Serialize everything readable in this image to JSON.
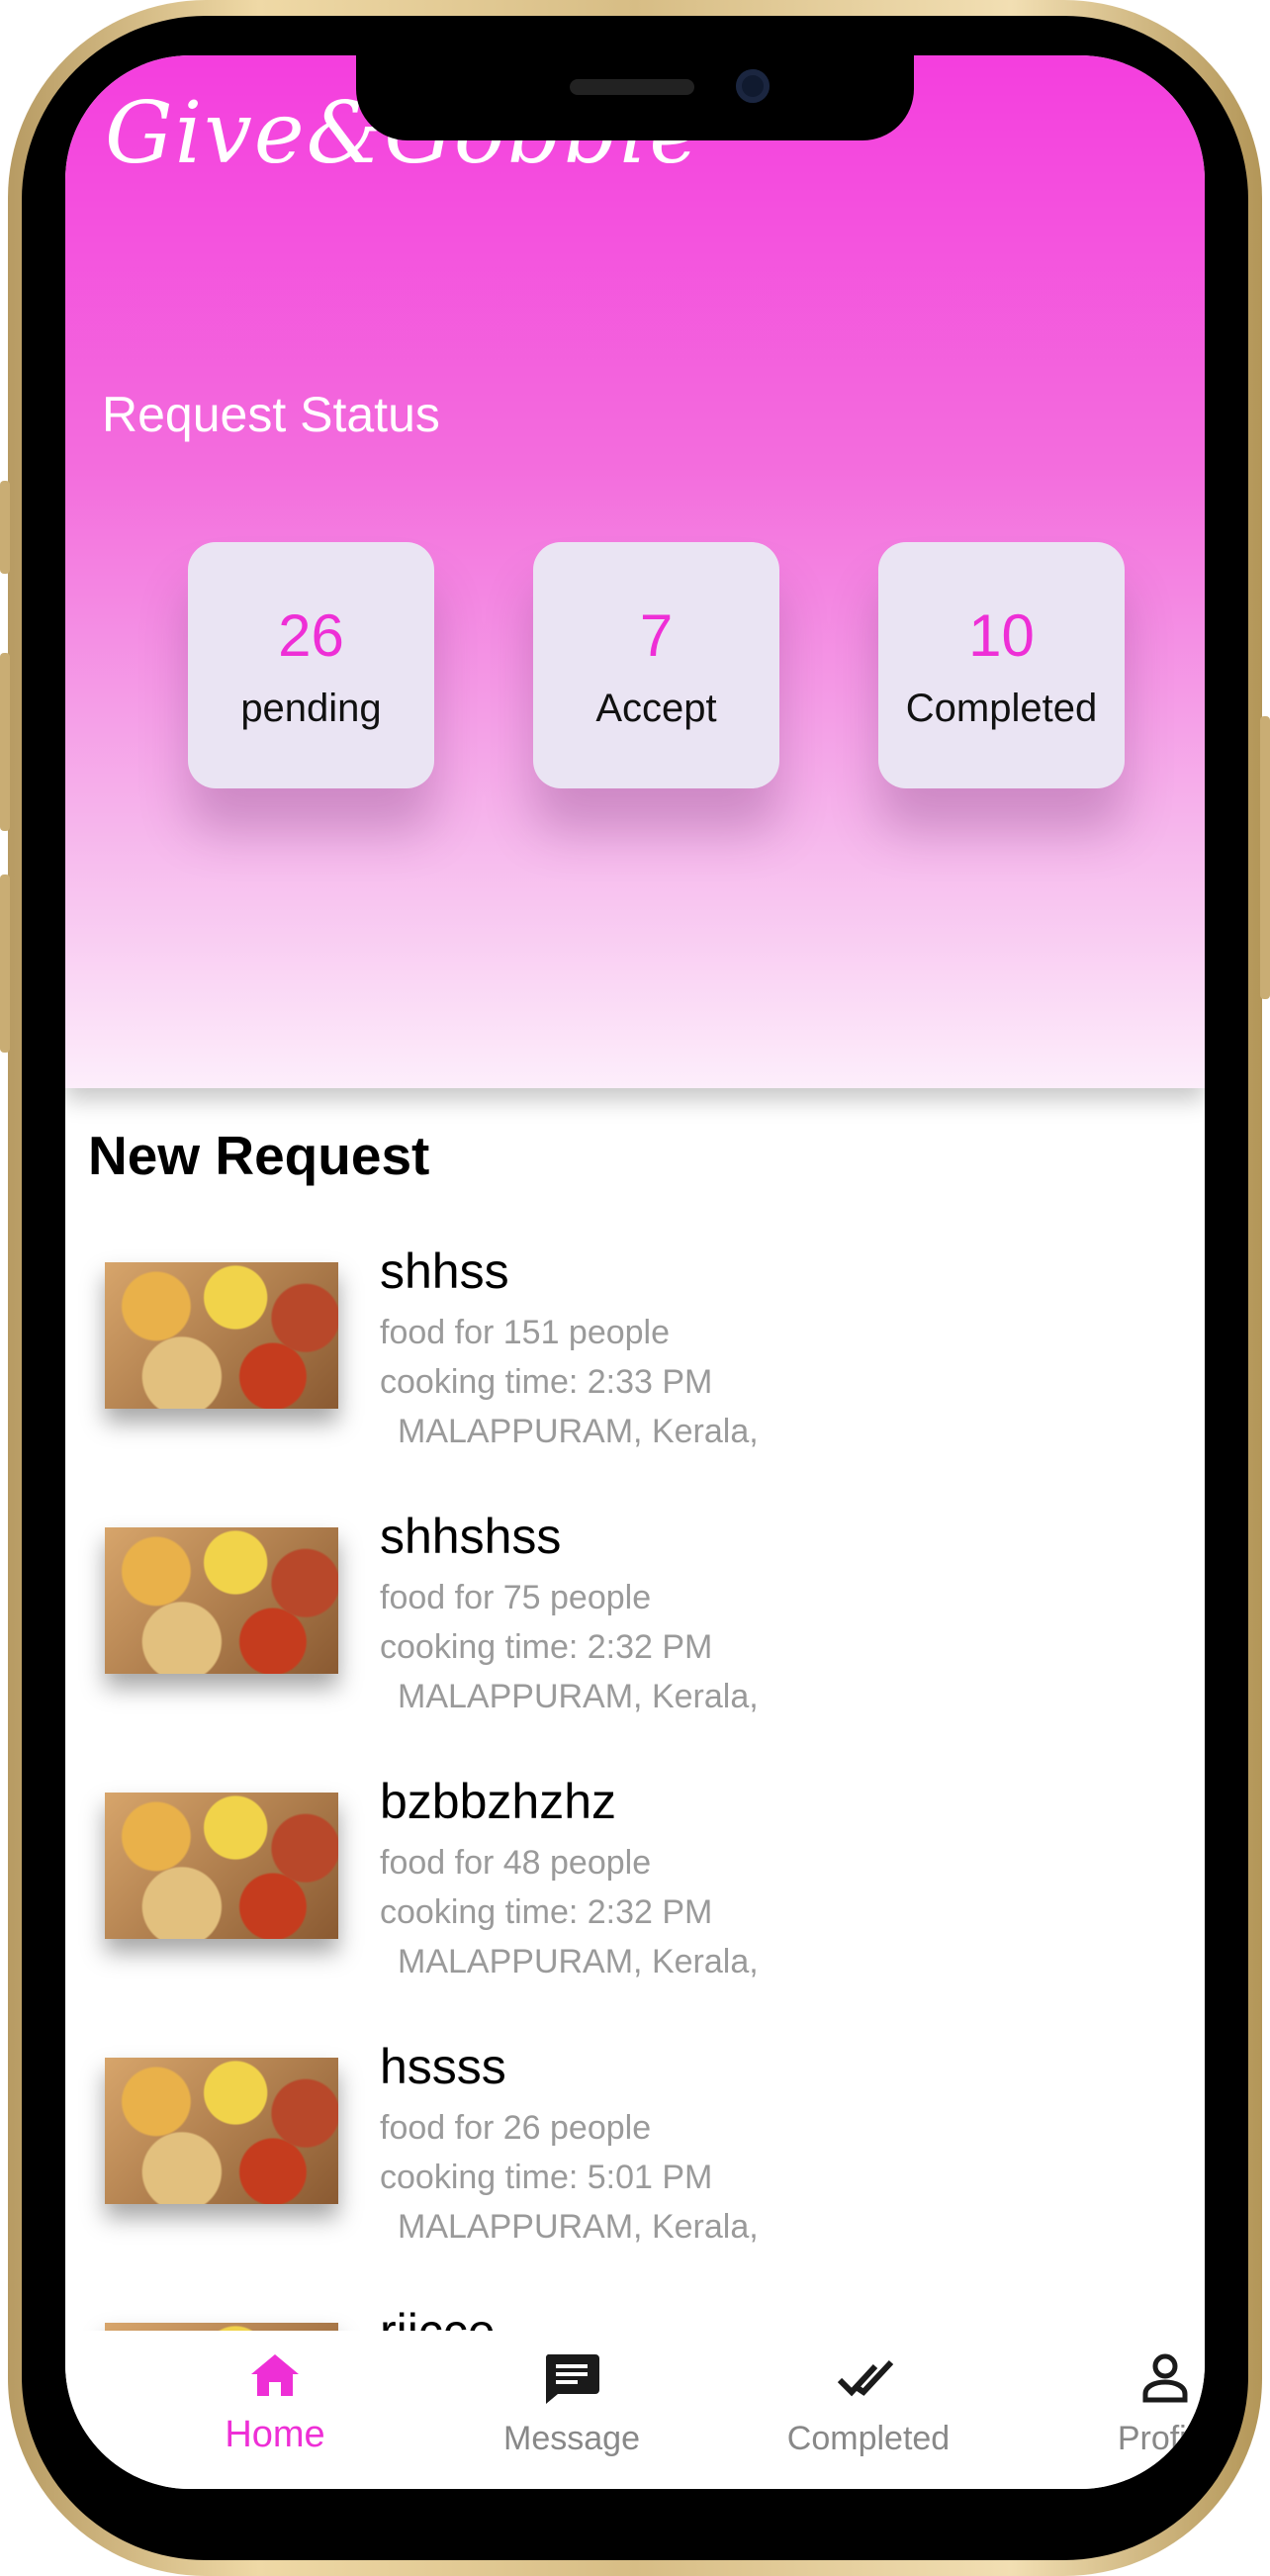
{
  "app": {
    "logo": "Give&Gobble"
  },
  "status": {
    "title": "Request Status",
    "cards": [
      {
        "value": "26",
        "label": "pending"
      },
      {
        "value": "7",
        "label": "Accept"
      },
      {
        "value": "10",
        "label": "Completed"
      }
    ]
  },
  "requests": {
    "title": "New Request",
    "items": [
      {
        "name": "shhss",
        "food": "food for 151 people",
        "time": "cooking time:  2:33 PM",
        "location": "MALAPPURAM, Kerala,"
      },
      {
        "name": "shhshss",
        "food": "food for 75 people",
        "time": "cooking time:  2:32 PM",
        "location": "MALAPPURAM, Kerala,"
      },
      {
        "name": "bzbbzhzhz",
        "food": "food for 48 people",
        "time": "cooking time:  2:32 PM",
        "location": "MALAPPURAM, Kerala,"
      },
      {
        "name": "hssss",
        "food": "food for 26 people",
        "time": "cooking time:  5:01 PM",
        "location": "MALAPPURAM, Kerala,"
      },
      {
        "name": "riicce"
      }
    ]
  },
  "nav": {
    "home": "Home",
    "message": "Message",
    "completed": "Completed",
    "profile": "Profile"
  },
  "colors": {
    "accent": "#ee2fd6",
    "header_top": "#f43ede",
    "card_bg": "#eae4f3"
  }
}
